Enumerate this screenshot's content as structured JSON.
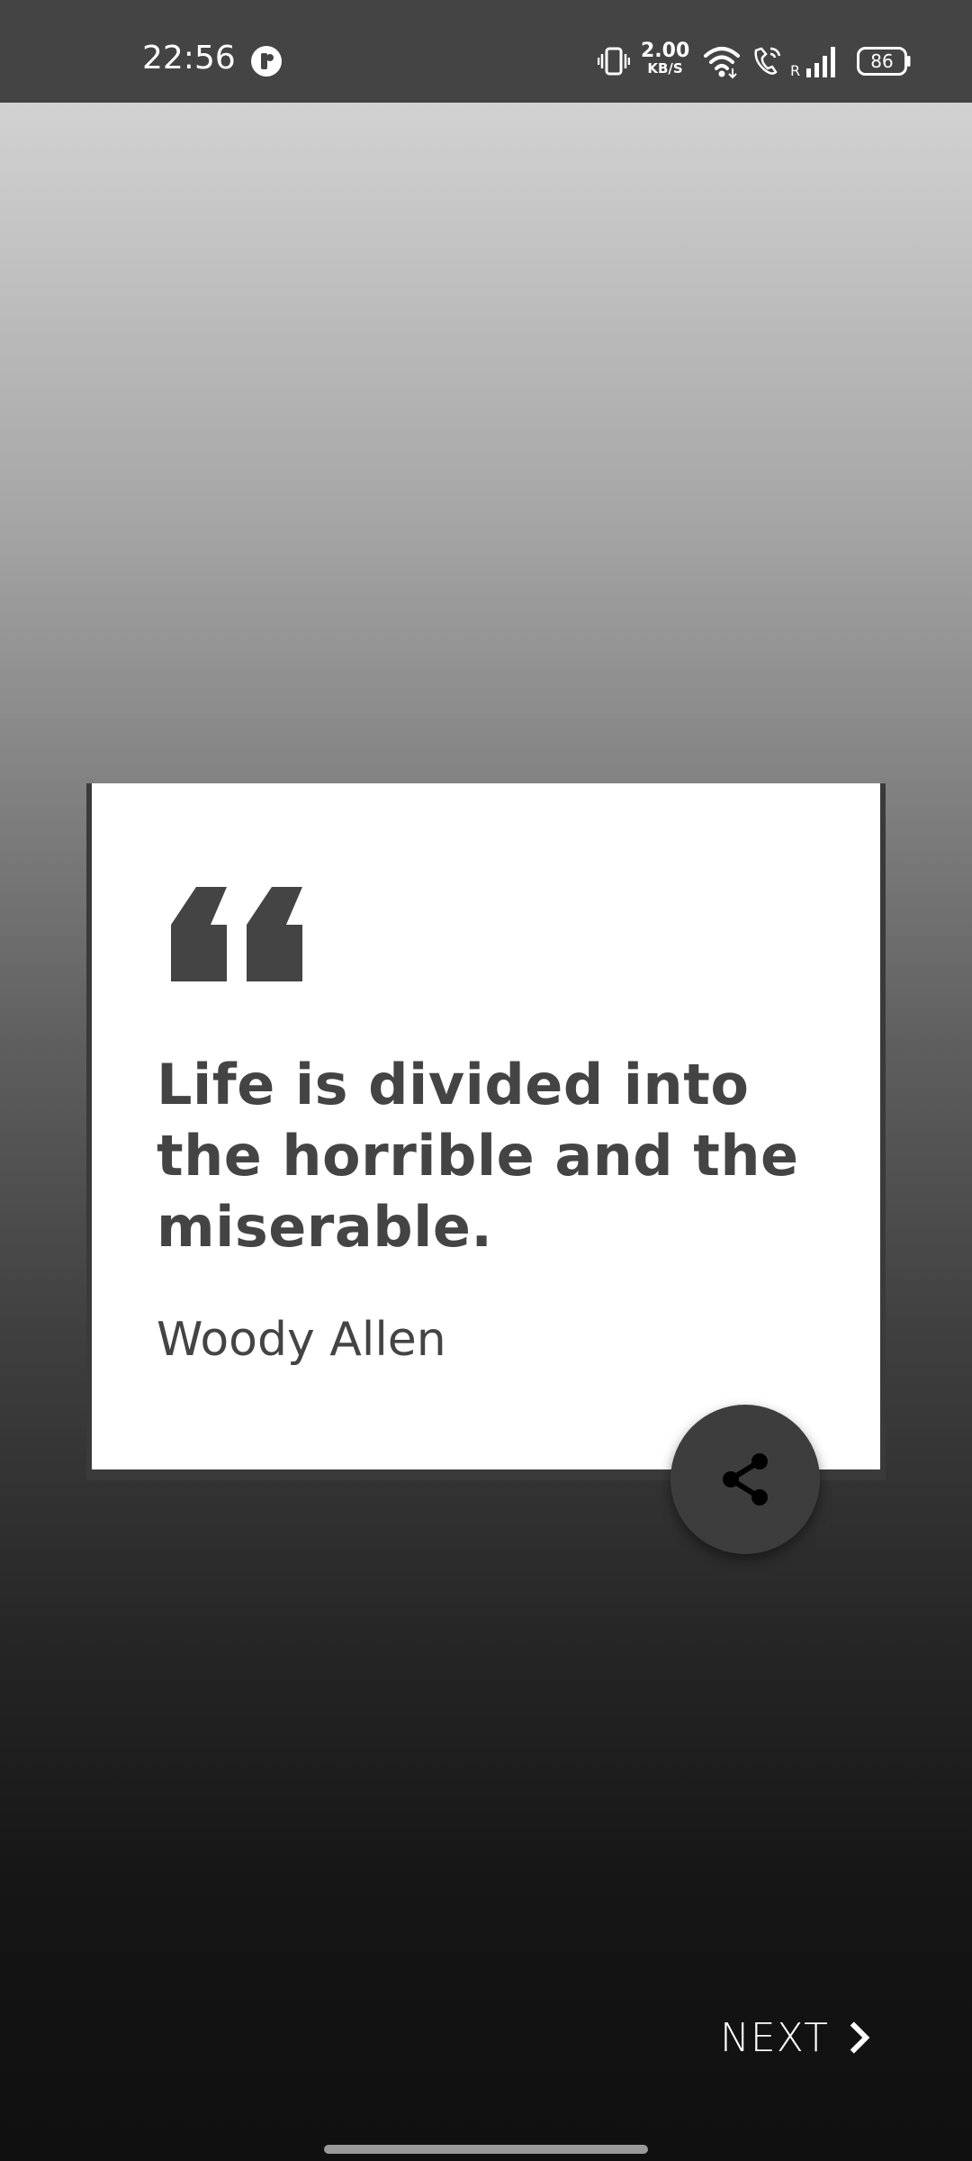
{
  "status_bar": {
    "time": "22:56",
    "net_speed_value": "2.00",
    "net_speed_unit": "KB/S",
    "signal_label": "R",
    "battery": "86"
  },
  "quote": {
    "text": "Life is divided into the horrible and the miserable.",
    "author": "Woody Allen"
  },
  "actions": {
    "next_label": "NEXT"
  },
  "icons": {
    "app": "app-circle-icon",
    "vibrate": "vibrate-icon",
    "wifi": "wifi-icon",
    "call": "wifi-call-icon",
    "signal": "signal-icon",
    "battery": "battery-icon",
    "quote": "quote-mark-icon",
    "share": "share-icon",
    "next": "chevron-right-icon"
  },
  "colors": {
    "status_bar": "#444444",
    "card": "#ffffff",
    "text": "#444444",
    "share_button": "#3d3d3d"
  }
}
